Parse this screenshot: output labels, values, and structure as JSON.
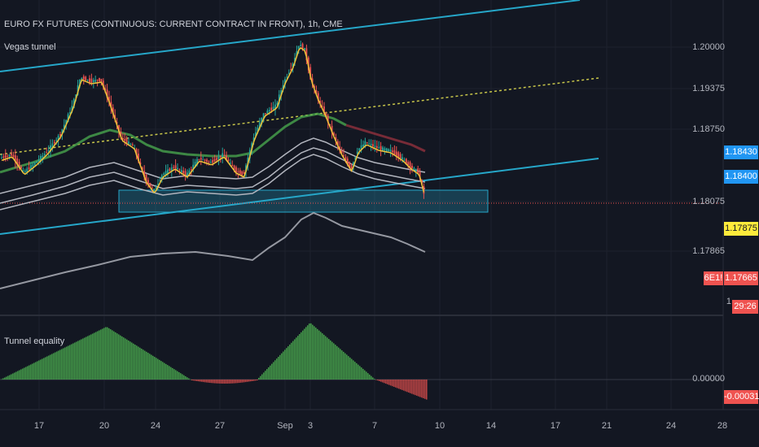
{
  "header": {
    "symbol_title": "EURO FX FUTURES (CONTINUOUS: CURRENT CONTRACT IN FRONT), 1h, CME"
  },
  "main_pane": {
    "indicator_label": "Vegas tunnel",
    "price_labels": [
      "1.20000",
      "1.19375",
      "1.18750",
      "1.18075",
      "1.17865",
      "1"
    ],
    "badges": [
      {
        "text": "1.18430",
        "bg": "#2196f3",
        "fg": "#ffffff"
      },
      {
        "text": "1.18400",
        "bg": "#2196f3",
        "fg": "#ffffff"
      },
      {
        "text": "1.17875",
        "bg": "#ffeb3b",
        "fg": "#131722"
      },
      {
        "text": "1.17665",
        "bg": "#ef5350",
        "fg": "#ffffff"
      },
      {
        "text": "29:26",
        "bg": "#ef5350",
        "fg": "#ffffff"
      }
    ],
    "symbol_tag": "6E1!"
  },
  "sub_pane": {
    "indicator_label": "Tunnel equality",
    "price_labels": [
      "0.00000"
    ],
    "value_badge": {
      "text": "-0.00031",
      "bg": "#ef5350",
      "fg": "#ffffff"
    }
  },
  "time_axis": {
    "labels": [
      "17",
      "20",
      "24",
      "27",
      "Sep",
      "3",
      "7",
      "10",
      "14",
      "17",
      "21",
      "24",
      "28"
    ]
  },
  "colors": {
    "background": "#131722",
    "channel": "#26a7c9",
    "midline": "#c8c64a",
    "ema_fast": "#f0c43a",
    "tunnel_green": "#4caf50",
    "tunnel_red": "#8b2f3b",
    "grey_ma": "#b2b5be",
    "up_candle": "#26a69a",
    "down_candle": "#ef5350",
    "hist_pos": "#4caf50",
    "hist_neg": "#ef5350"
  }
}
